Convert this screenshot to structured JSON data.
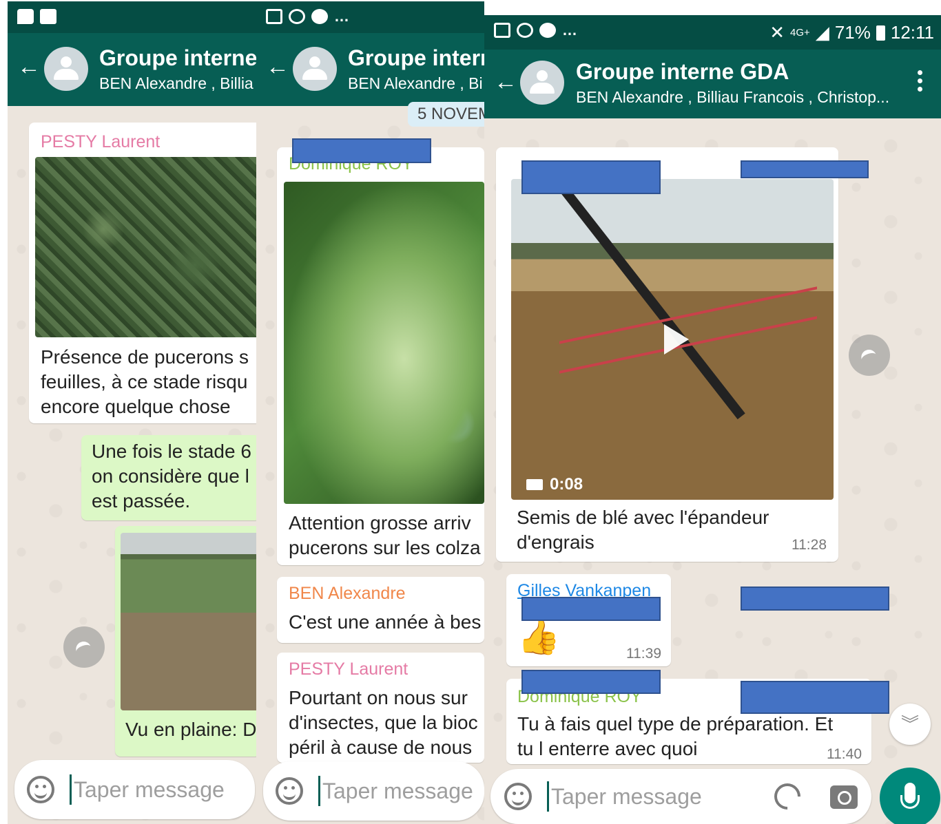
{
  "panel1": {
    "header": {
      "title": "Groupe interne",
      "subtitle": "BEN Alexandre , Billia"
    },
    "messages": [
      {
        "sender": "PESTY Laurent",
        "lines": [
          "Présence de pucerons s",
          "feuilles, à ce stade risqu",
          "encore quelque chose"
        ]
      },
      {
        "lines": [
          "Une fois le stade 6",
          "on considère que l",
          "est passée."
        ]
      },
      {
        "lines": [
          "Vu en plaine: D"
        ]
      }
    ],
    "input": {
      "placeholder": "Taper message"
    }
  },
  "panel2": {
    "header": {
      "title": "Groupe intern",
      "subtitle": "BEN Alexandre , Bi"
    },
    "date_chip": "5 NOVEM",
    "messages": [
      {
        "sender": "Dominique ROY",
        "lines": [
          "Attention grosse arriv",
          "pucerons sur les colza"
        ]
      },
      {
        "sender": "BEN Alexandre",
        "lines": [
          "C'est une année à bes"
        ]
      },
      {
        "sender": "PESTY Laurent",
        "lines": [
          "Pourtant on nous sur",
          "d'insectes, que la bioc",
          "péril à cause de nous"
        ]
      }
    ],
    "input": {
      "placeholder": "Taper message"
    }
  },
  "panel3": {
    "status": {
      "signal_label": "4G+",
      "battery": "71%",
      "time": "12:11"
    },
    "header": {
      "title": "Groupe interne GDA",
      "subtitle": "BEN Alexandre , Billiau Francois , Christop..."
    },
    "messages": [
      {
        "video_duration": "0:08",
        "lines": [
          "Semis de blé avec l'épandeur",
          "d'engrais"
        ],
        "time": "11:28"
      },
      {
        "sender": "Gilles Vankanpen",
        "emoji": "👍",
        "time": "11:39"
      },
      {
        "sender": "Dominique ROY",
        "lines": [
          "Tu à fais quel type de préparation.  Et",
          "tu l enterre avec quoi"
        ],
        "time": "11:40"
      }
    ],
    "input": {
      "placeholder": "Taper message"
    }
  },
  "colors": {
    "header": "#075e54",
    "statusbar": "#054d44",
    "sender_pink": "#e57ba5",
    "sender_green": "#8bc34a",
    "sender_orange": "#f0874a",
    "sender_blue": "#1e88e5",
    "redaction": "#4472c4",
    "mic": "#00897b"
  }
}
